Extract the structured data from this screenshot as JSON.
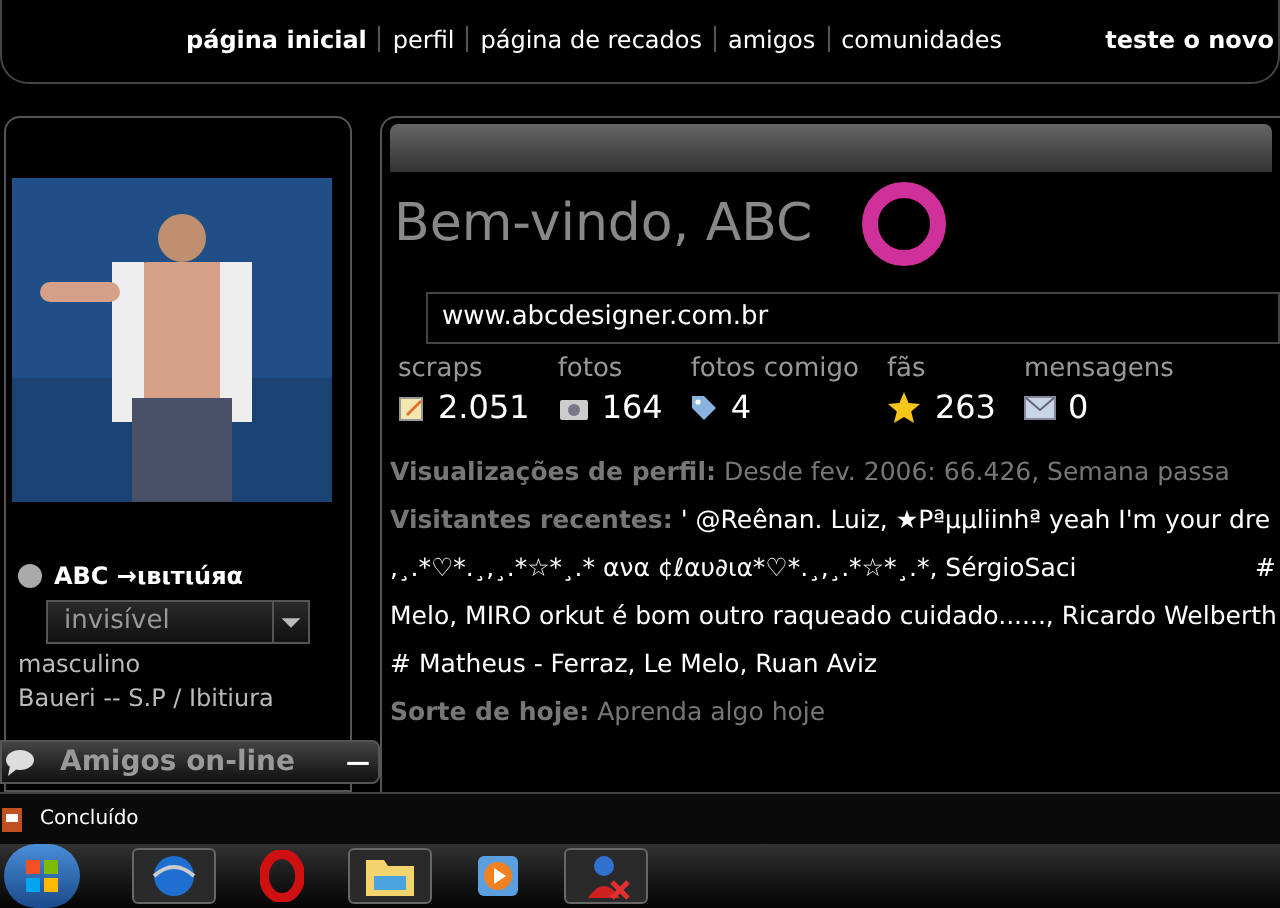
{
  "nav": {
    "items": [
      {
        "label": "página inicial",
        "selected": true
      },
      {
        "label": "perfil",
        "selected": false
      },
      {
        "label": "página de recados",
        "selected": false
      },
      {
        "label": "amigos",
        "selected": false
      },
      {
        "label": "comunidades",
        "selected": false
      }
    ],
    "right_text": "teste o novo"
  },
  "profile": {
    "name": "ABC →ιвιтιúяα",
    "status": "invisível",
    "details": [
      "masculino",
      "Baueri -- S.P / Ibitiura"
    ]
  },
  "main": {
    "welcome": "Bem-vindo, ABC",
    "url": "www.abcdesigner.com.br",
    "stats": [
      {
        "kind": "scraps",
        "label": "scraps",
        "value": "2.051"
      },
      {
        "kind": "photos",
        "label": "fotos",
        "value": "164"
      },
      {
        "kind": "tag",
        "label": "fotos comigo",
        "value": "4"
      },
      {
        "kind": "star",
        "label": "fãs",
        "value": "263"
      },
      {
        "kind": "mail",
        "label": "mensagens",
        "value": "0"
      }
    ],
    "views": {
      "label": "Visualizações de perfil:",
      "text": "Desde fev. 2006: 66.426, Semana passa"
    },
    "visitors": {
      "label": "Visitantes recentes:",
      "lines": [
        "' @Reênan. Luiz, ★Pªµµliinhª yeah I'm your dre",
        ",¸.*♡*.¸,¸.*☆*¸.* ανα ¢ℓαυ∂ια*♡*.¸,¸.*☆*¸.*, SérgioSaci",
        "Melo, MIRO orkut é bom outro raqueado cuidado......, Ricardo Welberth",
        "# Matheus - Ferraz, Le Melo, Ruan Aviz"
      ],
      "edge_mark": "#"
    },
    "luck": {
      "label": "Sorte de hoje:",
      "text": "Aprenda algo hoje"
    }
  },
  "friends_panel": {
    "title": "Amigos on-line",
    "minimize": "—"
  },
  "status_bar": {
    "text": "Concluído"
  },
  "taskbar": {
    "apps": [
      {
        "kind": "globe",
        "selected": true
      },
      {
        "kind": "opera",
        "selected": false
      },
      {
        "kind": "folder",
        "selected": true
      },
      {
        "kind": "player",
        "selected": false
      },
      {
        "kind": "messenger",
        "selected": true
      }
    ]
  }
}
